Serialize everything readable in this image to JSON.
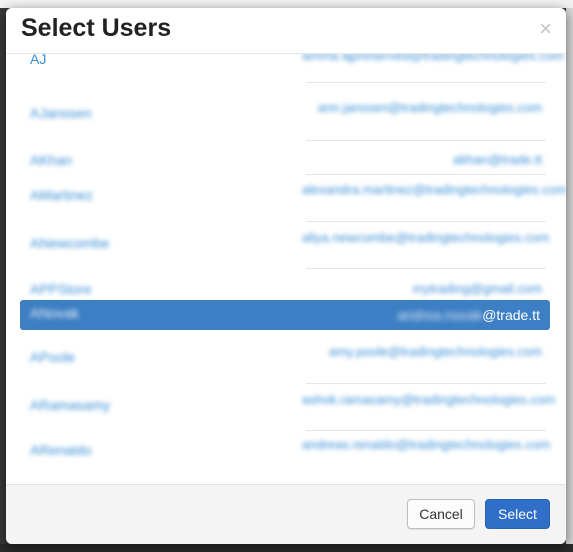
{
  "modal": {
    "title": "Select Users",
    "close_glyph": "×"
  },
  "users": [
    {
      "name": "AJ",
      "email": "amma.ajpreserved@tradingtechnologies.com"
    },
    {
      "name": "AJanssen",
      "email": "ann.janssen@tradingtechnologies.com"
    },
    {
      "name": "AKhan",
      "email": "akhan@trade.tt"
    },
    {
      "name": "AMartinez",
      "email": "alexandra.martinez@tradingtechnologies.com"
    },
    {
      "name": "ANewcombe",
      "email": "aliya.newcombe@tradingtechnologies.com"
    },
    {
      "name": "APPStore",
      "email": "mytrading@gmail.com"
    },
    {
      "name": "ANovak",
      "email_hidden": "andrea.novak",
      "email_visible": "@trade.tt"
    },
    {
      "name": "APoole",
      "email": "amy.poole@tradingtechnologies.com"
    },
    {
      "name": "ARamasamy",
      "email": "ashok.ramasamy@tradingtechnologies.com"
    },
    {
      "name": "ARenaldo",
      "email": "andreas.renaldo@tradingtechnologies.com"
    }
  ],
  "footer": {
    "cancel_label": "Cancel",
    "select_label": "Select"
  },
  "colors": {
    "link": "#3a8fd6",
    "selected_row": "#3d7fc4",
    "primary_button": "#2f6fc8"
  }
}
